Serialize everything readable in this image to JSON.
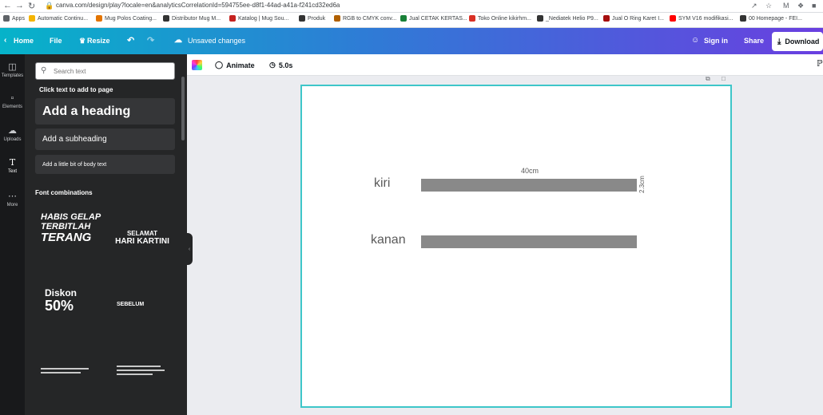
{
  "browser": {
    "url": "canva.com/design/play?locale=en&analyticsCorrelationId=594755ee-d8f1-44ad-a41a-f241cd32ed6a",
    "bookmarks": [
      {
        "label": "Apps",
        "color": "#5f6368"
      },
      {
        "label": "Automatic Continu...",
        "color": "#f4b400"
      },
      {
        "label": "Mug Polos Coating...",
        "color": "#e37400"
      },
      {
        "label": "Distributor Mug M...",
        "color": "#333333"
      },
      {
        "label": "Katalog | Mug Sou...",
        "color": "#c5221f"
      },
      {
        "label": "Produk",
        "color": "#333333"
      },
      {
        "label": "RGB to CMYK conv...",
        "color": "#b06000"
      },
      {
        "label": "Jual CETAK KERTAS...",
        "color": "#188038"
      },
      {
        "label": "Toko Online kikirhm...",
        "color": "#d93025"
      },
      {
        "label": "_Nediatek Helio P9...",
        "color": "#333333"
      },
      {
        "label": "Jual O Ring Karet I...",
        "color": "#a50e0e"
      },
      {
        "label": "SYM V16 modifikasi...",
        "color": "#ff0000"
      },
      {
        "label": "00 Homepage - FEI...",
        "color": "#333333"
      }
    ]
  },
  "topbar": {
    "home": "Home",
    "file": "File",
    "resize": "Resize",
    "status": "Unsaved changes",
    "signin": "Sign in",
    "share": "Share",
    "download": "Download"
  },
  "rail": [
    {
      "label": "Templates",
      "icon": "template-icon"
    },
    {
      "label": "Elements",
      "icon": "elements-icon"
    },
    {
      "label": "Uploads",
      "icon": "upload-icon"
    },
    {
      "label": "Text",
      "icon": "text-icon"
    },
    {
      "label": "More",
      "icon": "more-icon"
    }
  ],
  "panel": {
    "search_placeholder": "Search text",
    "click_text": "Click text to add to page",
    "heading": "Add a heading",
    "subheading": "Add a subheading",
    "body": "Add a little bit of body text",
    "font_combinations": "Font combinations",
    "combos": {
      "c1_line1": "HABIS GELAP",
      "c1_line2": "TERBITLAH",
      "c1_line3": "TERANG",
      "c2_line1": "SELAMAT",
      "c2_line2": "HARI KARTINI",
      "c3_line1": "Diskon",
      "c3_line2": "50%",
      "c4_line1": "SEBELUM"
    }
  },
  "editor_toolbar": {
    "animate": "Animate",
    "duration": "5.0s"
  },
  "canvas": {
    "width_label": "40cm",
    "height_label": "2.3cm",
    "left_label": "kiri",
    "right_label": "kanan",
    "bar_color": "#898989",
    "border_color": "#3ec6c9"
  }
}
